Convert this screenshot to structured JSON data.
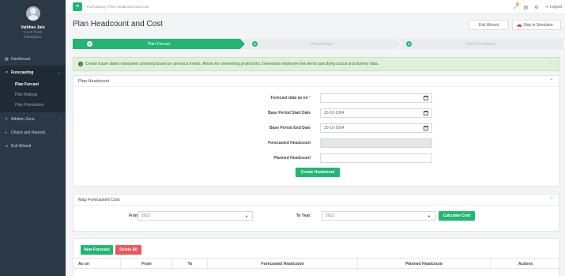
{
  "user": {
    "name": "Vaibhav Jain",
    "line1": "C & B Team",
    "line2": "StartupBuz"
  },
  "nav": {
    "dashboard": "Dashboard",
    "forecasting": "Forecasting",
    "sub": [
      "Plan Forcast",
      "Plan Ratings",
      "Plan Promotions"
    ],
    "attrition": "Attrition Zone",
    "charts": "Charts and Reports",
    "exit": "Exit Wizard"
  },
  "topbar": {
    "breadcrumb": "Forecasting  /  Plan Headcount and Cost",
    "notification_count": "1",
    "logout": "Logout"
  },
  "page": {
    "title": "Plan Headcount and Cost",
    "exit_wizard": "Exit Wizard",
    "skip_simulator": "Skip to Simulator"
  },
  "wizard": {
    "steps": [
      {
        "num": "1",
        "label": "Plan Forcast"
      },
      {
        "num": "2",
        "label": "Plan Ratings"
      },
      {
        "num": "3",
        "label": "Plan Promotions"
      }
    ]
  },
  "alert": {
    "text": "Create future dated manpower planning based on previous trends. Allows for overwriting projections. Generates employee line items specifying actual and dummy data.",
    "close": "×"
  },
  "headcount": {
    "panel_title": "Plan Headcount",
    "forecast_label": "Forecast data as on",
    "forecast_value": "",
    "start_label": "Base Period Start Date",
    "start_value": "20-10-2004",
    "end_label": "Base Period End Date",
    "end_value": "20-10-2004",
    "forecasted_label": "Forecasted Headcount",
    "forecasted_value": "",
    "planned_label": "Planned Headcount",
    "planned_value": "",
    "create_button": "Create Headcount"
  },
  "cost": {
    "panel_title": "Map Forecasted Cost",
    "from_label": "From Year:",
    "from_value": "2013",
    "to_label": "To Year:",
    "to_value": "2013",
    "calc_button": "Calculate Cost"
  },
  "forecast_table": {
    "new_button": "New Forecast",
    "delete_button": "Delete All",
    "columns": [
      "As on",
      "From",
      "To",
      "Forecasted Headcount",
      "Planned Headcount",
      "Actions"
    ]
  },
  "colors": {
    "accent": "#22b573",
    "sidebar": "#2b3845",
    "danger": "#e9565c",
    "alert_bg": "#dff0d8"
  }
}
